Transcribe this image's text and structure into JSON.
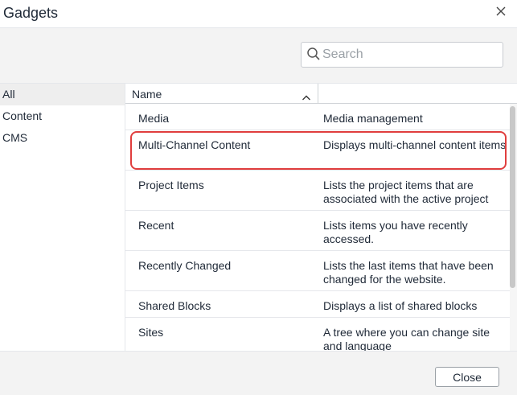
{
  "dialog": {
    "title": "Gadgets"
  },
  "search": {
    "placeholder": "Search",
    "value": ""
  },
  "sidebar": {
    "items": [
      {
        "label": "All",
        "active": true
      },
      {
        "label": "Content",
        "active": false
      },
      {
        "label": "CMS",
        "active": false
      }
    ]
  },
  "grid": {
    "columns": [
      {
        "label": "Name",
        "sort": "ascending"
      },
      {
        "label": ""
      }
    ],
    "rows": [
      {
        "name": "Media",
        "description": "Media management"
      },
      {
        "name": "Multi-Channel Content",
        "description": "Displays multi-channel content items",
        "highlighted": true
      },
      {
        "name": "Project Items",
        "description": "Lists the project items that are associated with the active project"
      },
      {
        "name": "Recent",
        "description": "Lists items you have recently accessed."
      },
      {
        "name": "Recently Changed",
        "description": "Lists the last items that have been changed for the website."
      },
      {
        "name": "Shared Blocks",
        "description": "Displays a list of shared blocks"
      },
      {
        "name": "Sites",
        "description": "A tree where you can change site and language"
      }
    ]
  },
  "footer": {
    "close_label": "Close"
  },
  "icons": {
    "close": "close-icon",
    "search": "search-icon",
    "sort": "chevron-up-icon"
  },
  "colors": {
    "highlight_border": "#e03e3e",
    "toolbar_bg": "#f3f3f3",
    "active_category_bg": "#eeeeee"
  }
}
